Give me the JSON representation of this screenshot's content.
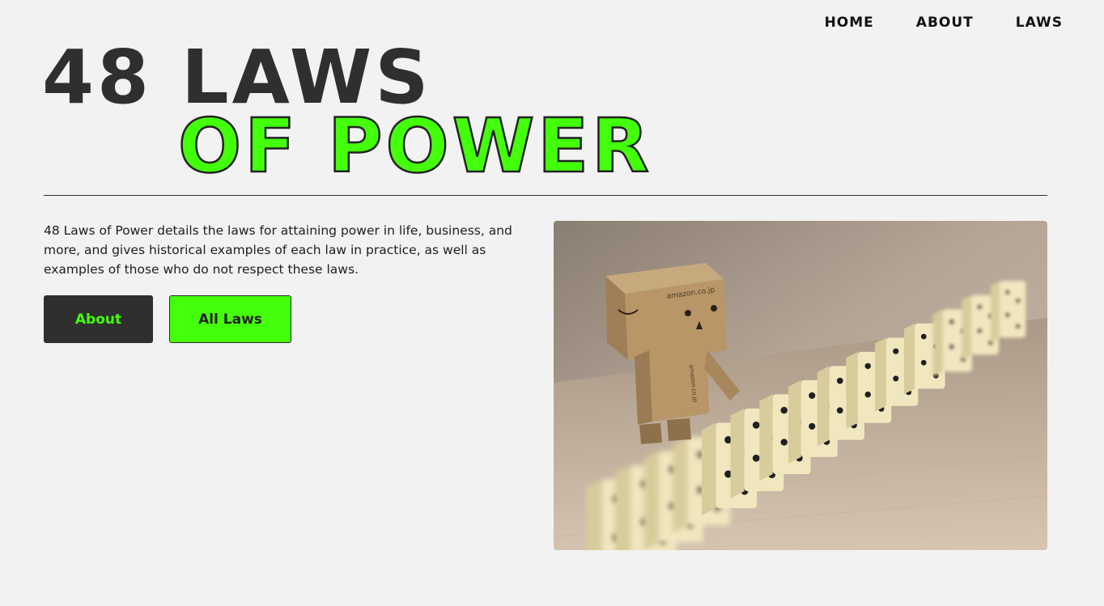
{
  "nav": {
    "items": [
      "HOME",
      "ABOUT",
      "LAWS"
    ]
  },
  "hero": {
    "line1": "48 LAWS",
    "line2": "OF POWER"
  },
  "intro": {
    "text": "48 Laws of Power details the laws for attaining power in life, business, and more, and gives historical examples of each law in practice, as well as examples of those who do not respect these laws."
  },
  "buttons": {
    "about_label": "About",
    "all_laws_label": "All Laws"
  },
  "colors": {
    "accent": "#44ff0a",
    "dark": "#2f2f2f",
    "background": "#f2f2f2"
  },
  "photo": {
    "box_text": "amazon.co.jp"
  }
}
